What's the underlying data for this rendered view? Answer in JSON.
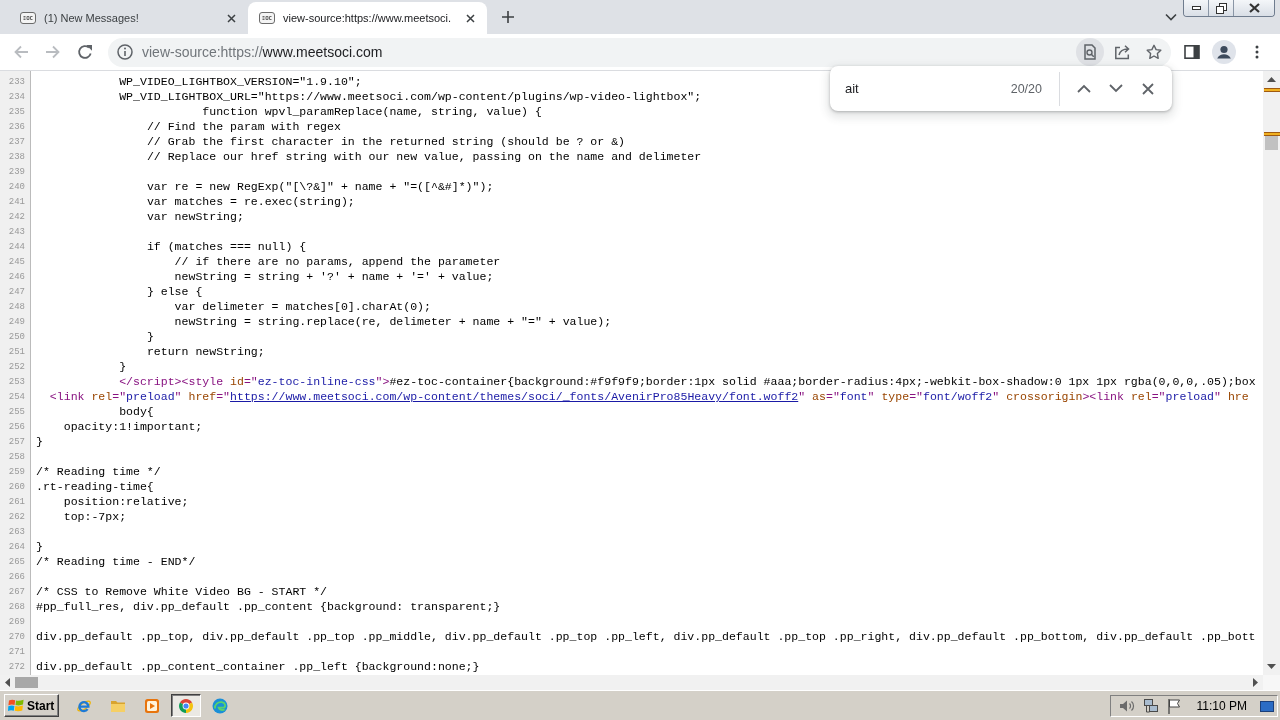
{
  "tabs": [
    {
      "title": "(1) New Messages!",
      "selected": false
    },
    {
      "title": "view-source:https://www.meetsoci.",
      "selected": true
    }
  ],
  "toolbar": {
    "back": {
      "disabled": true
    },
    "forward": {
      "disabled": true
    },
    "address": {
      "scheme": "view-source:https://",
      "host": "www.meetsoci.com"
    },
    "find_active": true
  },
  "find_bar": {
    "query": "ait",
    "count": "20/20"
  },
  "source": {
    "lines": [
      {
        "number": "233",
        "text": "            WP_VIDEO_LIGHTBOX_VERSION=\"1.9.10\";"
      },
      {
        "number": "234",
        "text": "            WP_VID_LIGHTBOX_URL=\"https://www.meetsoci.com/wp-content/plugins/wp-video-lightbox\";"
      },
      {
        "number": "235",
        "text": "                        function wpvl_paramReplace(name, string, value) {"
      },
      {
        "number": "236",
        "text": "                // Find the param with regex"
      },
      {
        "number": "237",
        "text": "                // Grab the first character in the returned string (should be ? or &)"
      },
      {
        "number": "238",
        "text": "                // Replace our href string with our new value, passing on the name and delimeter"
      },
      {
        "number": "239"
      },
      {
        "number": "240",
        "text": "                var re = new RegExp(\"[\\?&]\" + name + \"=([^&#]*)\");"
      },
      {
        "number": "241",
        "text": "                var matches = re.exec(string);"
      },
      {
        "number": "242",
        "text": "                var newString;"
      },
      {
        "number": "243"
      },
      {
        "number": "244",
        "text": "                if (matches === null) {"
      },
      {
        "number": "245",
        "text": "                    // if there are no params, append the parameter"
      },
      {
        "number": "246",
        "text": "                    newString = string + '?' + name + '=' + value;"
      },
      {
        "number": "247",
        "text": "                } else {"
      },
      {
        "number": "248",
        "text": "                    var delimeter = matches[0].charAt(0);"
      },
      {
        "number": "249",
        "text": "                    newString = string.replace(re, delimeter + name + \"=\" + value);"
      },
      {
        "number": "250",
        "text": "                }"
      },
      {
        "number": "251",
        "text": "                return newString;"
      },
      {
        "number": "252",
        "text": "            }"
      },
      {
        "number": "253",
        "tokens": [
          {
            "kind": "tag",
            "text": "            </script><style "
          },
          {
            "kind": "attr",
            "text": "id"
          },
          {
            "kind": "tag",
            "text": "=\""
          },
          {
            "kind": "value",
            "text": "ez-toc-inline-css"
          },
          {
            "kind": "tag",
            "text": "\">"
          },
          {
            "kind": "text",
            "text": "#ez-toc-container{background:#f9f9f9;border:1px solid #aaa;border-radius:4px;-webkit-box-shadow:0 1px 1px rgba(0,0,0,.05);box"
          }
        ]
      },
      {
        "number": "254",
        "tokens": [
          {
            "kind": "tag",
            "text": "  <link "
          },
          {
            "kind": "attr",
            "text": "rel"
          },
          {
            "kind": "tag",
            "text": "=\""
          },
          {
            "kind": "value",
            "text": "preload"
          },
          {
            "kind": "tag",
            "text": "\" "
          },
          {
            "kind": "attr",
            "text": "href"
          },
          {
            "kind": "tag",
            "text": "=\""
          },
          {
            "kind": "link",
            "text": "https://www.meetsoci.com/wp-content/themes/soci/_fonts/AvenirPro85Heavy/font.woff2"
          },
          {
            "kind": "tag",
            "text": "\" "
          },
          {
            "kind": "attr",
            "text": "as"
          },
          {
            "kind": "tag",
            "text": "=\""
          },
          {
            "kind": "value",
            "text": "font"
          },
          {
            "kind": "tag",
            "text": "\" "
          },
          {
            "kind": "attr",
            "text": "type"
          },
          {
            "kind": "tag",
            "text": "=\""
          },
          {
            "kind": "value",
            "text": "font/woff2"
          },
          {
            "kind": "tag",
            "text": "\" "
          },
          {
            "kind": "attr",
            "text": "crossorigin"
          },
          {
            "kind": "tag",
            "text": "><link "
          },
          {
            "kind": "attr",
            "text": "rel"
          },
          {
            "kind": "tag",
            "text": "=\""
          },
          {
            "kind": "value",
            "text": "preload"
          },
          {
            "kind": "tag",
            "text": "\" "
          },
          {
            "kind": "attr",
            "text": "hre"
          }
        ]
      },
      {
        "number": "255",
        "text": "            body{"
      },
      {
        "number": "256",
        "text": "    opacity:1!important;"
      },
      {
        "number": "257",
        "text": "}"
      },
      {
        "number": "258"
      },
      {
        "number": "259",
        "text": "/* Reading time */"
      },
      {
        "number": "260",
        "text": ".rt-reading-time{"
      },
      {
        "number": "261",
        "text": "    position:relative;"
      },
      {
        "number": "262",
        "text": "    top:-7px;"
      },
      {
        "number": "263"
      },
      {
        "number": "264",
        "text": "}"
      },
      {
        "number": "265",
        "text": "/* Reading time - END*/"
      },
      {
        "number": "266"
      },
      {
        "number": "267",
        "text": "/* CSS to Remove White Video BG - START */"
      },
      {
        "number": "268",
        "text": "#pp_full_res, div.pp_default .pp_content {background: transparent;}"
      },
      {
        "number": "269"
      },
      {
        "number": "270",
        "text": "div.pp_default .pp_top, div.pp_default .pp_top .pp_middle, div.pp_default .pp_top .pp_left, div.pp_default .pp_top .pp_right, div.pp_default .pp_bottom, div.pp_default .pp_bott"
      },
      {
        "number": "271"
      },
      {
        "number": "272",
        "text": "div.pp_default .pp_content_container .pp_left {background:none;}"
      }
    ]
  },
  "taskbar": {
    "start": "Start",
    "apps": [
      {
        "selected": false
      },
      {
        "selected": false
      },
      {
        "selected": false
      },
      {
        "selected": true
      },
      {
        "selected": false
      }
    ],
    "clock": "11:10 PM"
  }
}
